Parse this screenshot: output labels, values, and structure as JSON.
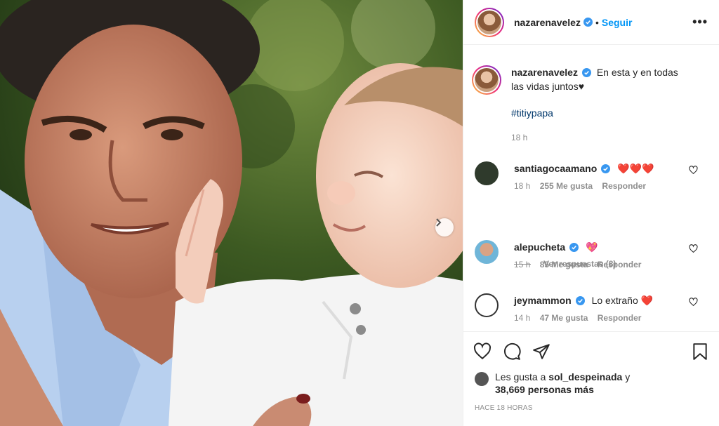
{
  "post": {
    "author": "nazarenavelez",
    "follow_label": "Seguir",
    "more_icon": "more-options-icon",
    "caption_lines": [
      "En esta y en todas",
      "las vidas juntos♥"
    ],
    "hashtag": "#titiypapa",
    "caption_time": "18 h"
  },
  "comments": [
    {
      "user": "santiagocaamano",
      "text": "❤️❤️❤️",
      "time": "18 h",
      "likes": "255 Me gusta",
      "reply": "Responder"
    },
    {
      "user": "alepucheta",
      "text": "💖",
      "time": "15 h",
      "likes": "85 Me gusta",
      "reply": "Responder"
    },
    {
      "user": "jeymammon",
      "text": "Lo extraño ❤️",
      "time": "14 h",
      "likes": "47 Me gusta",
      "reply": "Responder"
    }
  ],
  "view_replies": "Ver respuestas (8)",
  "likes": {
    "prefix": "Les gusta a",
    "user": "sol_despeinada",
    "suffix": "y",
    "count": "38,669 personas más"
  },
  "posted_ago": "HACE 18 HORAS",
  "colors": {
    "accent": "#0095f6",
    "verified": "#3897f0",
    "heart": "#ed4956"
  }
}
